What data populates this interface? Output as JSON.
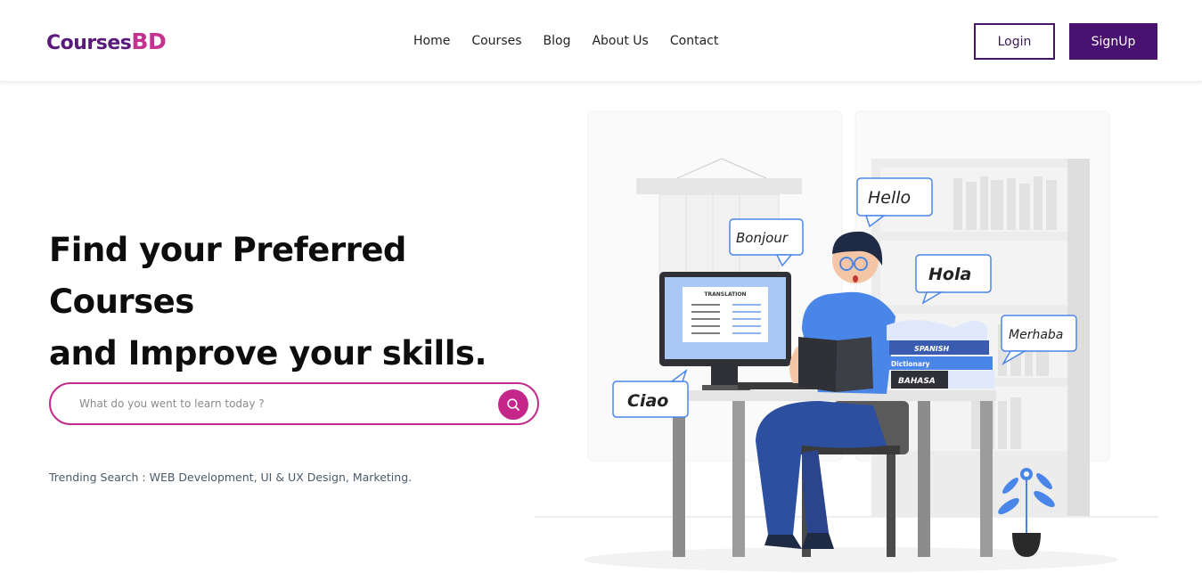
{
  "brand": {
    "part1": "Courses",
    "part2": "BD"
  },
  "nav": {
    "items": [
      {
        "label": "Home"
      },
      {
        "label": "Courses"
      },
      {
        "label": "Blog"
      },
      {
        "label": "About Us"
      },
      {
        "label": "Contact"
      }
    ]
  },
  "auth": {
    "login_label": "Login",
    "signup_label": "SignUp"
  },
  "hero": {
    "title_line1": "Find your Preferred Courses",
    "title_line2": "and Improve your skills.",
    "search_placeholder": "What do you went to learn today ?",
    "search_icon": "search-icon",
    "trending": "Trending Search : WEB Development, UI & UX Design, Marketing."
  },
  "illustration": {
    "bubbles": {
      "hello": "Hello",
      "bonjour": "Bonjour",
      "hola": "Hola",
      "merhaba": "Merhaba",
      "ciao": "Ciao"
    },
    "screen_title": "TRANSLATION",
    "books": {
      "spanish": "SPANISH",
      "dictionary": "Dictionary",
      "bahasa": "BAHASA"
    }
  },
  "colors": {
    "brand_dark": "#4a1270",
    "brand_pink": "#c4268a",
    "illustration_blue": "#4a86e8"
  }
}
